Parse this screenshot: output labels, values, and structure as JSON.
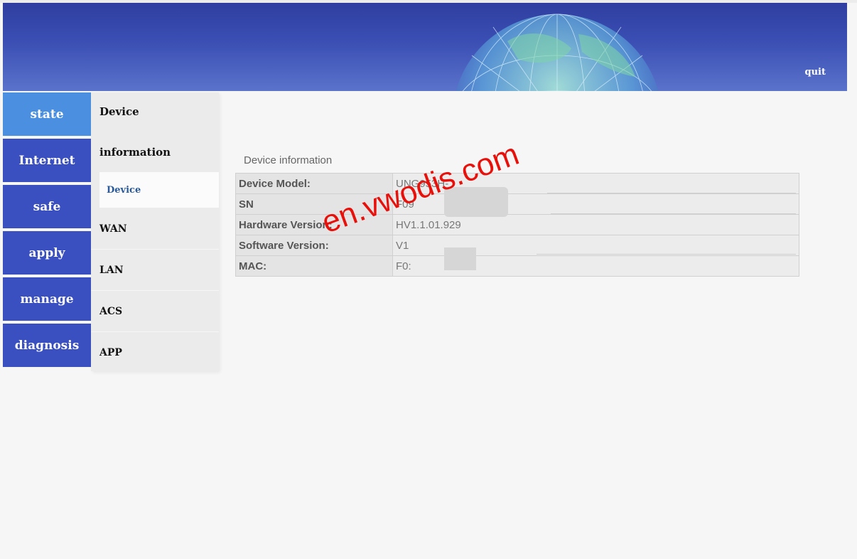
{
  "header": {
    "quit_label": "quit"
  },
  "nav": {
    "items": [
      {
        "label": "state",
        "active": true
      },
      {
        "label": "Internet"
      },
      {
        "label": "safe"
      },
      {
        "label": "apply"
      },
      {
        "label": "manage"
      },
      {
        "label": "diagnosis"
      }
    ]
  },
  "subnav": {
    "heading_line1": "Device",
    "heading_line2": "information",
    "active_item": "Device",
    "items": [
      "WAN",
      "LAN",
      "ACS",
      "APP"
    ]
  },
  "main": {
    "section_title": "Device information",
    "rows": [
      {
        "key": "Device Model:",
        "value": "UNG953H-"
      },
      {
        "key": "SN",
        "value": "F09"
      },
      {
        "key": "Hardware Version:",
        "value": "HV1.1.01.929"
      },
      {
        "key": "Software Version:",
        "value": "V1"
      },
      {
        "key": "MAC:",
        "value": "F0:"
      }
    ]
  },
  "watermark": "en.vwodis.com",
  "colors": {
    "nav_bg": "#3a4fc0",
    "nav_active": "#4a8fe0",
    "header_top": "#2f3ea0",
    "watermark": "#e8100a"
  }
}
